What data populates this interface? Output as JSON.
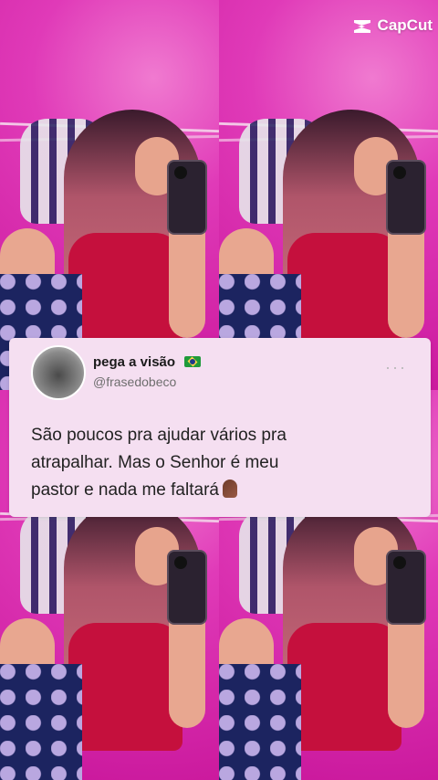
{
  "overlay": {
    "app_logo": "CapCut",
    "logo_icon": "capcut-logo-icon"
  },
  "tweet": {
    "display_name": "pega a visão",
    "flag_icon": "brazil-flag-icon",
    "handle": "@frasedobeco",
    "more_icon": "more-dots-icon",
    "text_lines": [
      "São poucos pra ajudar vários pra",
      "atrapalhar. Mas o Senhor é meu",
      "pastor e nada me faltará"
    ],
    "emoji_icon": "praying-hands-icon"
  },
  "colors": {
    "background": "#d61fa6",
    "card": "#f5dff1",
    "text": "#222222"
  }
}
